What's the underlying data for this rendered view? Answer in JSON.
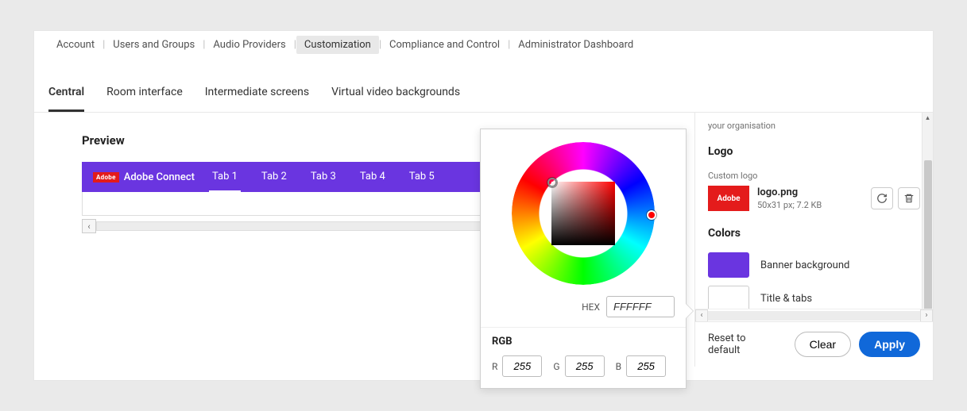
{
  "topnav": {
    "items": [
      "Account",
      "Users and Groups",
      "Audio Providers",
      "Customization",
      "Compliance and Control",
      "Administrator Dashboard"
    ],
    "active_index": 3
  },
  "subnav": {
    "items": [
      "Central",
      "Room interface",
      "Intermediate screens",
      "Virtual video backgrounds"
    ],
    "active_index": 0
  },
  "preview": {
    "title": "Preview",
    "brand_mark": "Adobe",
    "banner_title": "Adobe Connect",
    "tabs": [
      "Tab 1",
      "Tab 2",
      "Tab 3",
      "Tab 4",
      "Tab 5"
    ],
    "active_tab_index": 0,
    "banner_bg": "#6a35e0"
  },
  "sidebar": {
    "org_hint": "your organisation",
    "logo_heading": "Logo",
    "custom_logo_label": "Custom logo",
    "logo_filename": "logo.png",
    "logo_dims": "50x31 px; 7.2 KB",
    "logo_badge": "Adobe",
    "colors_heading": "Colors",
    "rows": [
      {
        "label": "Banner background",
        "color": "#6a35e0"
      },
      {
        "label": "Title & tabs",
        "color": "#ffffff"
      }
    ]
  },
  "footer": {
    "reset": "Reset to default",
    "clear": "Clear",
    "apply": "Apply"
  },
  "picker": {
    "hex_label": "HEX",
    "hex_value": "FFFFFF",
    "rgb_label": "RGB",
    "r_label": "R",
    "g_label": "G",
    "b_label": "B",
    "r": "255",
    "g": "255",
    "b": "255"
  }
}
